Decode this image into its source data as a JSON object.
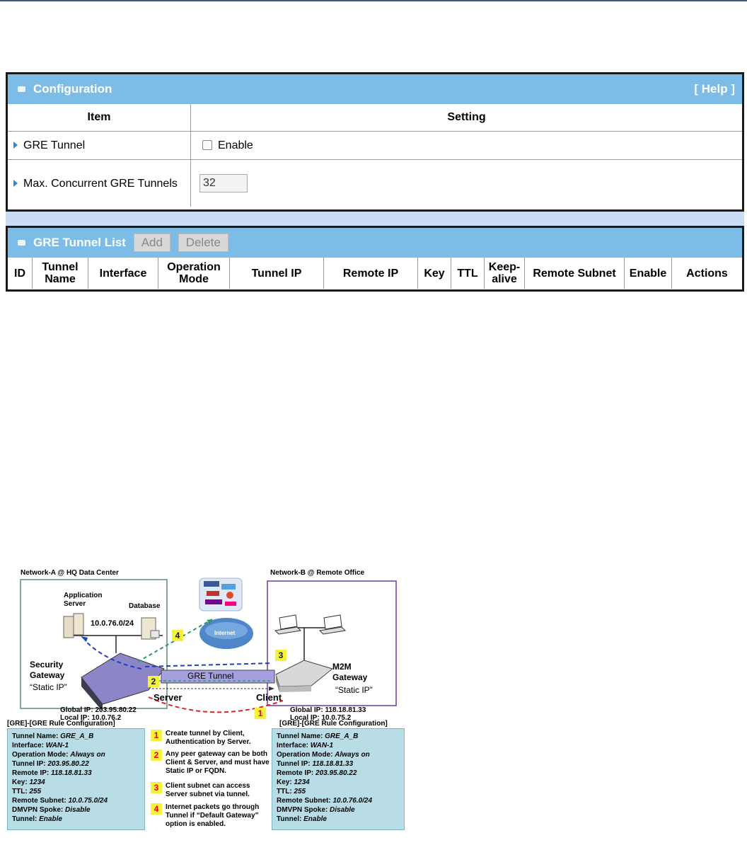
{
  "configuration": {
    "title": "Configuration",
    "help": "[ Help ]",
    "col_item": "Item",
    "col_setting": "Setting",
    "gre_tunnel_label": "GRE Tunnel",
    "enable_label": "Enable",
    "max_tunnels_label": "Max. Concurrent GRE Tunnels",
    "max_tunnels_value": "32"
  },
  "tunnel_list": {
    "title": "GRE Tunnel List",
    "add": "Add",
    "delete": "Delete",
    "columns": [
      "ID",
      "Tunnel Name",
      "Interface",
      "Operation Mode",
      "Tunnel IP",
      "Remote IP",
      "Key",
      "TTL",
      "Keep-alive",
      "Remote Subnet",
      "Enable",
      "Actions"
    ]
  },
  "diagram": {
    "network_a": "Network-A @ HQ Data Center",
    "network_b": "Network-B @ Remote Office",
    "app_server": "Application Server",
    "database": "Database",
    "subnet_a": "10.0.76.0/24",
    "security_gateway": "Security Gateway",
    "static_ip": "“Static IP”",
    "m2m_gateway": "M2M Gateway",
    "internet": "Internet",
    "gre_tunnel": "GRE Tunnel",
    "server": "Server",
    "client": "Client",
    "global_ip_a": "Global IP: 203.95.80.22",
    "local_ip_a": "Local IP: 10.0.76.2",
    "global_ip_b": "Global IP: 118.18.81.33",
    "local_ip_b": "Local IP: 10.0.75.2",
    "left_box_title": "[GRE]-[GRE Rule Configuration]",
    "right_box_title": "[GRE]-[GRE Rule Configuration]",
    "left_box": [
      {
        "k": "Tunnel Name: ",
        "v": "GRE_A_B"
      },
      {
        "k": "Interface: ",
        "v": "WAN-1"
      },
      {
        "k": "Operation Mode: ",
        "v": "Always on"
      },
      {
        "k": "Tunnel IP: ",
        "v": "203.95.80.22"
      },
      {
        "k": "Remote IP: ",
        "v": "118.18.81.33"
      },
      {
        "k": "Key: ",
        "v": "1234"
      },
      {
        "k": "TTL: ",
        "v": "255"
      },
      {
        "k": "Remote Subnet: ",
        "v": "10.0.75.0/24"
      },
      {
        "k": "DMVPN Spoke: ",
        "v": "Disable"
      },
      {
        "k": "Tunnel: ",
        "v": "Enable"
      }
    ],
    "right_box": [
      {
        "k": "Tunnel Name: ",
        "v": "GRE_A_B"
      },
      {
        "k": "Interface: ",
        "v": "WAN-1"
      },
      {
        "k": "Operation Mode: ",
        "v": "Always on"
      },
      {
        "k": "Tunnel IP: ",
        "v": "118.18.81.33"
      },
      {
        "k": "Remote IP: ",
        "v": "203.95.80.22"
      },
      {
        "k": "Key: ",
        "v": "1234"
      },
      {
        "k": "TTL: ",
        "v": "255"
      },
      {
        "k": "Remote Subnet: ",
        "v": "10.0.76.0/24"
      },
      {
        "k": "DMVPN Spoke: ",
        "v": "Disable"
      },
      {
        "k": "Tunnel: ",
        "v": "Enable"
      }
    ],
    "notes": [
      {
        "n": "1",
        "text": "Create tunnel by Client, Authentication by Server."
      },
      {
        "n": "2",
        "text": "Any peer gateway can be both Client & Server, and must have Static IP or FQDN."
      },
      {
        "n": "3",
        "text": "Client subnet can access Server subnet via tunnel."
      },
      {
        "n": "4",
        "text": "Internet packets go through Tunnel if “Default Gateway” option is enabled."
      }
    ]
  }
}
